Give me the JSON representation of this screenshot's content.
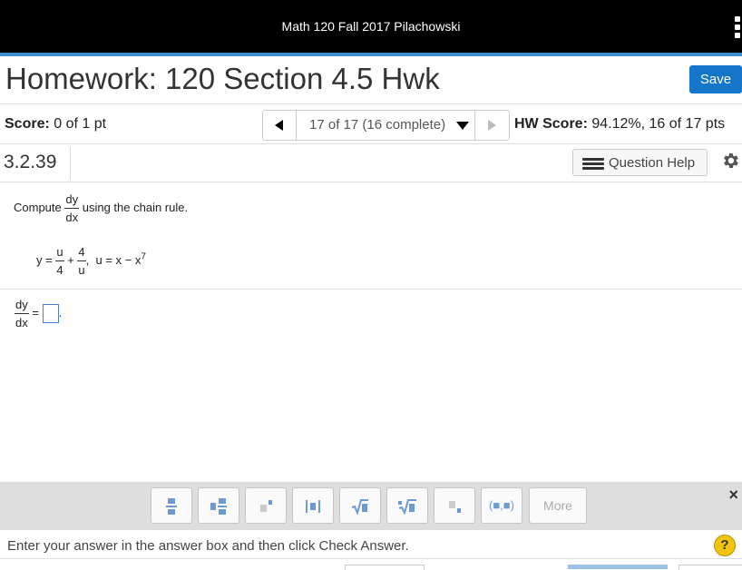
{
  "header": {
    "course_title": "Math 120 Fall 2017 Pilachowski",
    "accent_color": "#3b8fd1"
  },
  "homework": {
    "title": "Homework: 120 Section 4.5 Hwk",
    "save_label": "Save"
  },
  "score_bar": {
    "score_label": "Score:",
    "score_value": "0 of 1 pt",
    "question_selector": "17 of 17 (16 complete)",
    "hw_score_label": "HW Score:",
    "hw_score_value": "94.12%, 16 of 17 pts"
  },
  "question": {
    "number": "3.2.39",
    "help_label": "Question Help",
    "gear_icon": "gear-icon"
  },
  "problem": {
    "prompt_prefix": "Compute",
    "prompt_frac_num": "dy",
    "prompt_frac_den": "dx",
    "prompt_suffix": "using the chain rule.",
    "eq_y": "y =",
    "eq_frac1_num": "u",
    "eq_frac1_den": "4",
    "eq_plus": "+",
    "eq_frac2_num": "4",
    "eq_frac2_den": "u",
    "eq_comma": ",",
    "eq_u": "u = x − x",
    "eq_u_exp": "7",
    "answer_frac_num": "dy",
    "answer_frac_den": "dx",
    "answer_equals": "=",
    "answer_period": "."
  },
  "toolbar": {
    "buttons": [
      "fraction",
      "mixed-number",
      "exponent",
      "absolute-value",
      "square-root",
      "nth-root",
      "subscript",
      "interval"
    ],
    "interval_label": "(■,■)",
    "more_label": "More",
    "close_symbol": "×"
  },
  "footer": {
    "message": "Enter your answer in the answer box and then click Check Answer.",
    "help_symbol": "?"
  }
}
